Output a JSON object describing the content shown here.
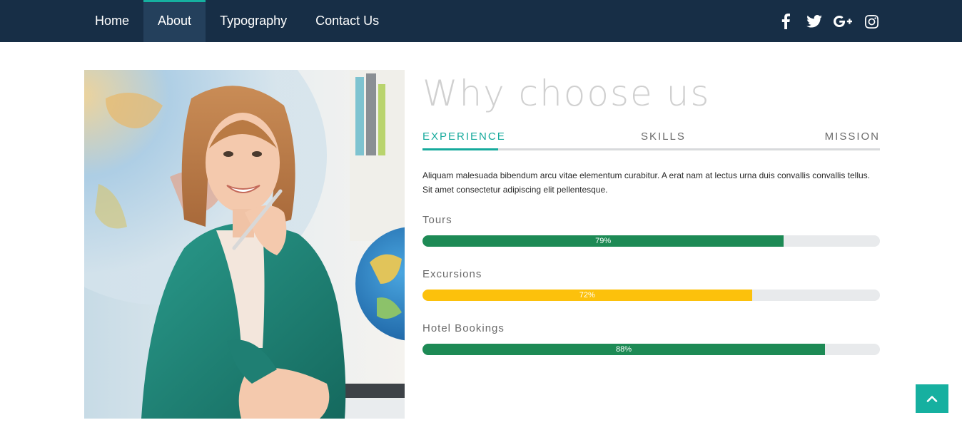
{
  "nav": {
    "items": [
      {
        "label": "Home",
        "active": false
      },
      {
        "label": "About",
        "active": true
      },
      {
        "label": "Typography",
        "active": false
      },
      {
        "label": "Contact Us",
        "active": false
      }
    ],
    "social": [
      "facebook-icon",
      "twitter-icon",
      "google-plus-icon",
      "instagram-icon"
    ]
  },
  "about": {
    "title": "Why choose us",
    "tabs": [
      {
        "label": "EXPERIENCE",
        "active": true
      },
      {
        "label": "SKILLS",
        "active": false
      },
      {
        "label": "MISSION",
        "active": false
      }
    ],
    "paragraph": "Aliquam malesuada bibendum arcu vitae elementum curabitur. A erat nam at lectus urna duis convallis convallis tellus. Sit amet consectetur adipiscing elit pellentesque.",
    "skills": [
      {
        "label": "Tours",
        "percent": 79,
        "text": "79%",
        "color": "#1d8a55"
      },
      {
        "label": "Excursions",
        "percent": 72,
        "text": "72%",
        "color": "#fcc10c"
      },
      {
        "label": "Hotel Bookings",
        "percent": 88,
        "text": "88%",
        "color": "#1d8a55"
      }
    ]
  },
  "colors": {
    "nav_bg": "#172e46",
    "accent": "#16aa9c"
  },
  "back_to_top_icon": "chevron-up-icon"
}
